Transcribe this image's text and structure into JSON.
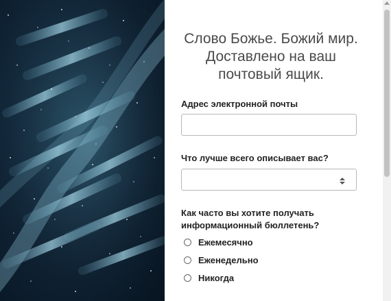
{
  "form": {
    "title": "Слово Божье. Божий мир. Доставлено на ваш почтовый ящик.",
    "email": {
      "label": "Адрес электронной почты",
      "value": "",
      "placeholder": ""
    },
    "describe": {
      "label": "Что лучше всего описывает вас?",
      "selected": ""
    },
    "frequency": {
      "label": "Как часто вы хотите получать информационный бюллетень?",
      "options": [
        "Ежемесячно",
        "Еженедельно",
        "Никогда"
      ]
    }
  },
  "hero": {
    "icon": "dna-strand-image"
  }
}
